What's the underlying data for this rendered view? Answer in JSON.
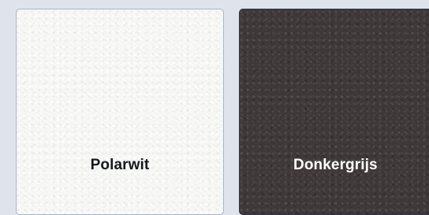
{
  "swatches": [
    {
      "label": "Polarwit",
      "color": "#f8f8f7"
    },
    {
      "label": "Donkergrijs",
      "color": "#3f3839"
    }
  ]
}
